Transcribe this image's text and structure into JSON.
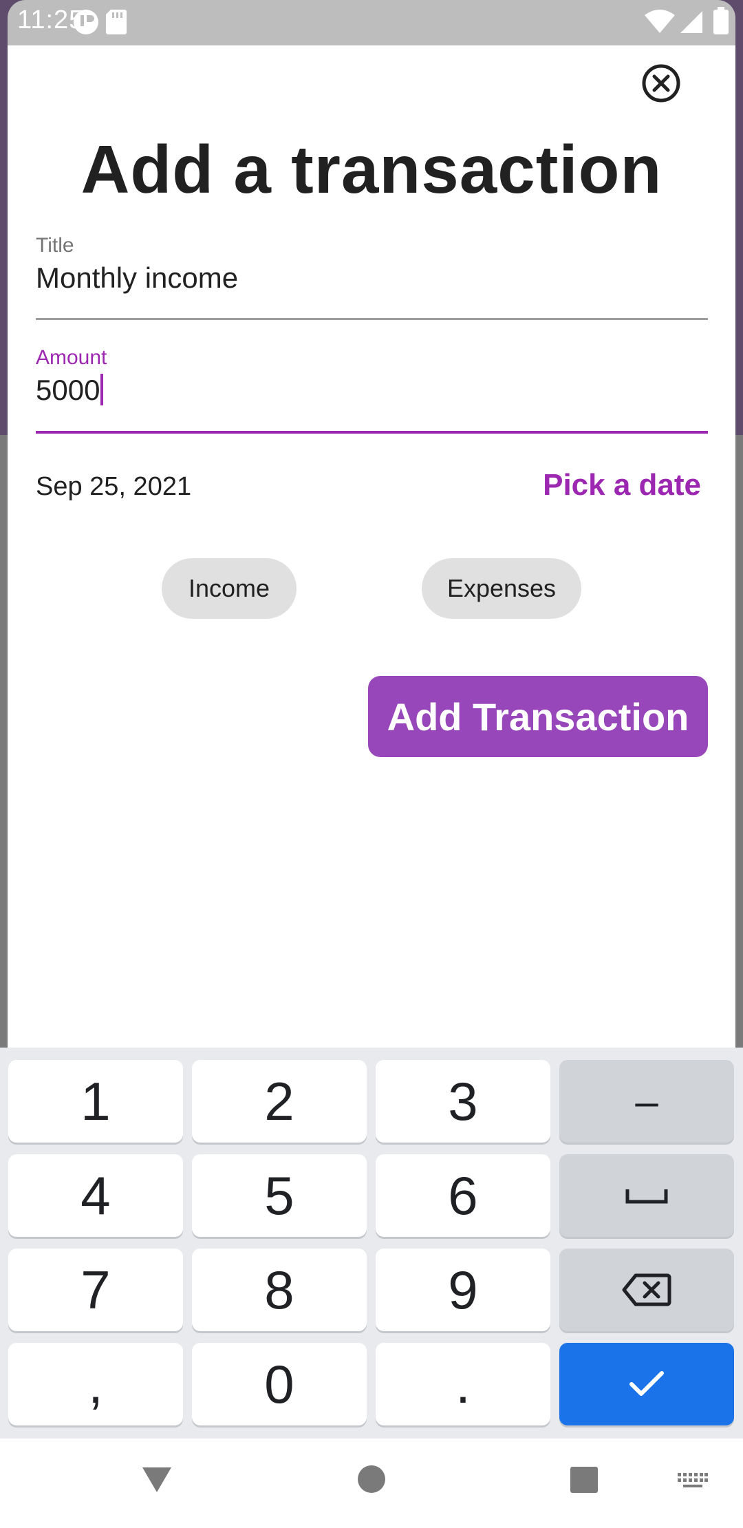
{
  "status_bar": {
    "time": "11:25",
    "icons": [
      "alert-icon",
      "sd-card-icon",
      "wifi-icon",
      "signal-icon",
      "battery-icon"
    ]
  },
  "sheet": {
    "title": "Add a transaction",
    "close_icon": "close-circle-icon"
  },
  "form": {
    "title_field": {
      "label": "Title",
      "value": "Monthly income"
    },
    "amount_field": {
      "label": "Amount",
      "value": "5000"
    },
    "date_value": "Sep 25, 2021",
    "pick_date_label": "Pick a date",
    "chips": [
      {
        "label": "Income"
      },
      {
        "label": "Expenses"
      }
    ],
    "submit_label": "Add Transaction"
  },
  "keyboard": {
    "keys": [
      "1",
      "2",
      "3",
      "–",
      "4",
      "5",
      "6",
      "␣",
      "7",
      "8",
      "9",
      "⌫",
      ",",
      "0",
      ".",
      "✓"
    ],
    "accent_color": "#1a73e8"
  },
  "nav_bar": {
    "buttons": [
      "back-icon",
      "home-icon",
      "recents-icon",
      "keyboard-icon"
    ]
  },
  "colors": {
    "accent": "#9c27b0",
    "button": "#9747b9",
    "chip": "#e0e0e0"
  }
}
